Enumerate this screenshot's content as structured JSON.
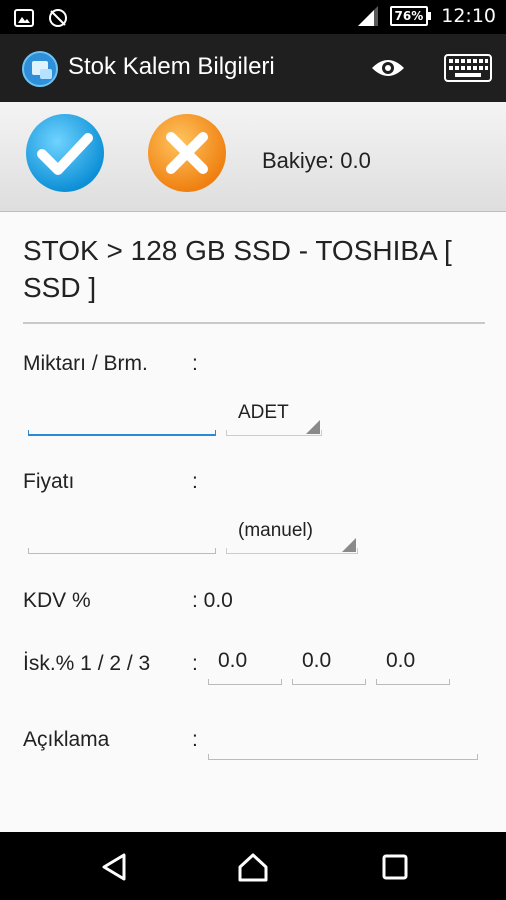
{
  "status_bar": {
    "battery": "76%",
    "time": "12:10"
  },
  "action_bar": {
    "title": "Stok Kalem Bilgileri"
  },
  "toolbar": {
    "balance": "Bakiye: 0.0"
  },
  "stock": {
    "title": "STOK > 128 GB SSD - TOSHIBA [ SSD ]"
  },
  "form": {
    "quantity": {
      "label": "Miktarı / Brm.",
      "colon": ":",
      "value": "",
      "unit": "ADET"
    },
    "price": {
      "label": "Fiyatı",
      "colon": ":",
      "value": "",
      "price_type": "(manuel)"
    },
    "vat": {
      "label": "KDV %",
      "value": ": 0.0"
    },
    "discount": {
      "label": "İsk.% 1 / 2 / 3",
      "colon": ":",
      "d1": "0.0",
      "d2": "0.0",
      "d3": "0.0"
    },
    "description": {
      "label": "Açıklama",
      "colon": ":",
      "value": ""
    }
  },
  "icons": {
    "ok": "check-icon",
    "cancel": "x-icon",
    "view": "eye-icon",
    "keyboard": "keyboard-icon"
  },
  "colors": {
    "ok_blue": "#1ea6e6",
    "cancel_orange": "#f28a1c",
    "focus_blue": "#2a8ad8"
  }
}
